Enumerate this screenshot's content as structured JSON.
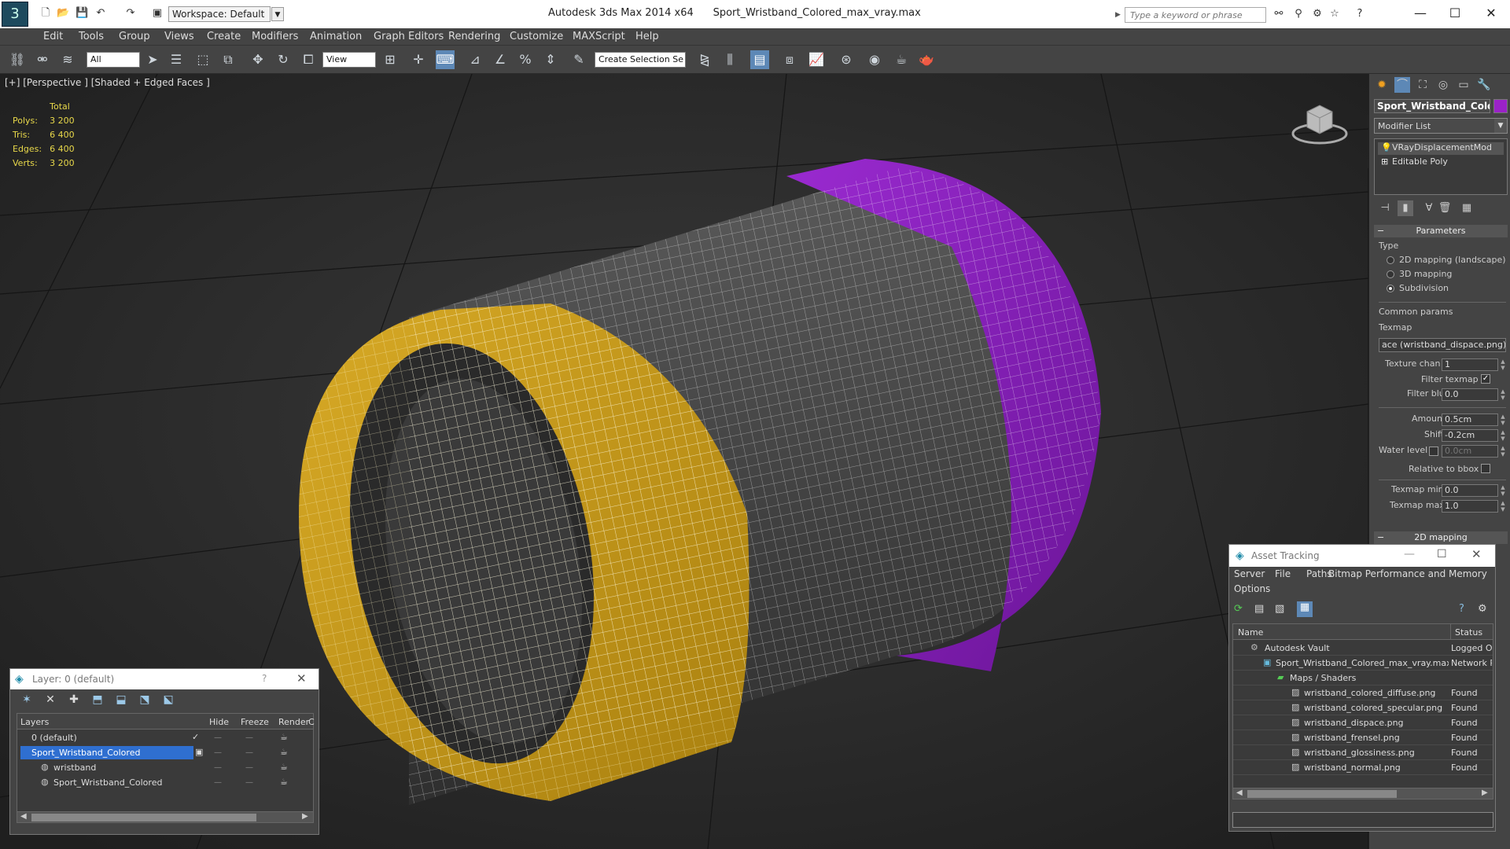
{
  "app": {
    "title": "Autodesk 3ds Max  2014 x64",
    "file": "Sport_Wristband_Colored_max_vray.max",
    "workspace": "Workspace: Default",
    "search_placeholder": "Type a keyword or phrase",
    "logo": "3"
  },
  "menus": [
    "Edit",
    "Tools",
    "Group",
    "Views",
    "Create",
    "Modifiers",
    "Animation",
    "Graph Editors",
    "Rendering",
    "Customize",
    "MAXScript",
    "Help"
  ],
  "toolbar": {
    "filter": "All",
    "ref_coord": "View",
    "selection_set": "Create Selection Se"
  },
  "viewport": {
    "label": "[+] [Perspective ] [Shaded + Edged Faces ]",
    "stats_header": "Total",
    "stats": [
      {
        "label": "Polys:",
        "value": "3 200"
      },
      {
        "label": "Tris:",
        "value": "6 400"
      },
      {
        "label": "Edges:",
        "value": "6 400"
      },
      {
        "label": "Verts:",
        "value": "3 200"
      }
    ]
  },
  "command_panel": {
    "object_name": "Sport_Wristband_Colored",
    "object_color": "#9a22c8",
    "modifier_list": "Modifier List",
    "stack": [
      "VRayDisplacementMod",
      "Editable Poly"
    ],
    "parameters": "Parameters",
    "type_label": "Type",
    "type_options": [
      "2D mapping (landscape)",
      "3D mapping",
      "Subdivision"
    ],
    "type_selected": 2,
    "common_params": "Common params",
    "texmap_label": "Texmap",
    "texmap_value": "ace (wristband_dispace.png)",
    "texture_chan_label": "Texture chan",
    "texture_chan": "1",
    "filter_texmap_label": "Filter texmap",
    "filter_blur_label": "Filter blur",
    "filter_blur": "0.0",
    "amount_label": "Amount",
    "amount": "0.5cm",
    "shift_label": "Shift",
    "shift": "-0.2cm",
    "water_level_label": "Water level",
    "water_level": "0.0cm",
    "relative_bbox_label": "Relative to bbox",
    "texmap_min_label": "Texmap min",
    "texmap_min": "0.0",
    "texmap_max_label": "Texmap max",
    "texmap_max": "1.0",
    "next_rollout": "2D mapping"
  },
  "layer_dialog": {
    "title": "Layer: 0 (default)",
    "help": "?",
    "columns": [
      "Layers",
      "Hide",
      "Freeze",
      "Render",
      "C"
    ],
    "rows": [
      {
        "name": "0 (default)",
        "indent": 1
      },
      {
        "name": "Sport_Wristband_Colored",
        "indent": 1
      },
      {
        "name": "wristband",
        "indent": 2
      },
      {
        "name": "Sport_Wristband_Colored",
        "indent": 2
      }
    ],
    "selected": 1
  },
  "asset_tracking": {
    "title": "Asset Tracking",
    "menus": [
      "Server",
      "File",
      "Paths",
      "Bitmap Performance and Memory",
      "Options"
    ],
    "columns": [
      "Name",
      "Status"
    ],
    "rows": [
      {
        "name": "Autodesk Vault",
        "status": "Logged O",
        "indent": 1
      },
      {
        "name": "Sport_Wristband_Colored_max_vray.max",
        "status": "Network P",
        "indent": 2
      },
      {
        "name": "Maps / Shaders",
        "status": "",
        "indent": 3
      },
      {
        "name": "wristband_colored_diffuse.png",
        "status": "Found",
        "indent": 4
      },
      {
        "name": "wristband_colored_specular.png",
        "status": "Found",
        "indent": 4
      },
      {
        "name": "wristband_dispace.png",
        "status": "Found",
        "indent": 4
      },
      {
        "name": "wristband_frensel.png",
        "status": "Found",
        "indent": 4
      },
      {
        "name": "wristband_glossiness.png",
        "status": "Found",
        "indent": 4
      },
      {
        "name": "wristband_normal.png",
        "status": "Found",
        "indent": 4
      }
    ]
  },
  "colors": {
    "yellow_band": "#c89a1e",
    "gray_band": "#4a4a4a",
    "purple_band": "#8a1fc0",
    "selection": "#2f6fd0"
  }
}
